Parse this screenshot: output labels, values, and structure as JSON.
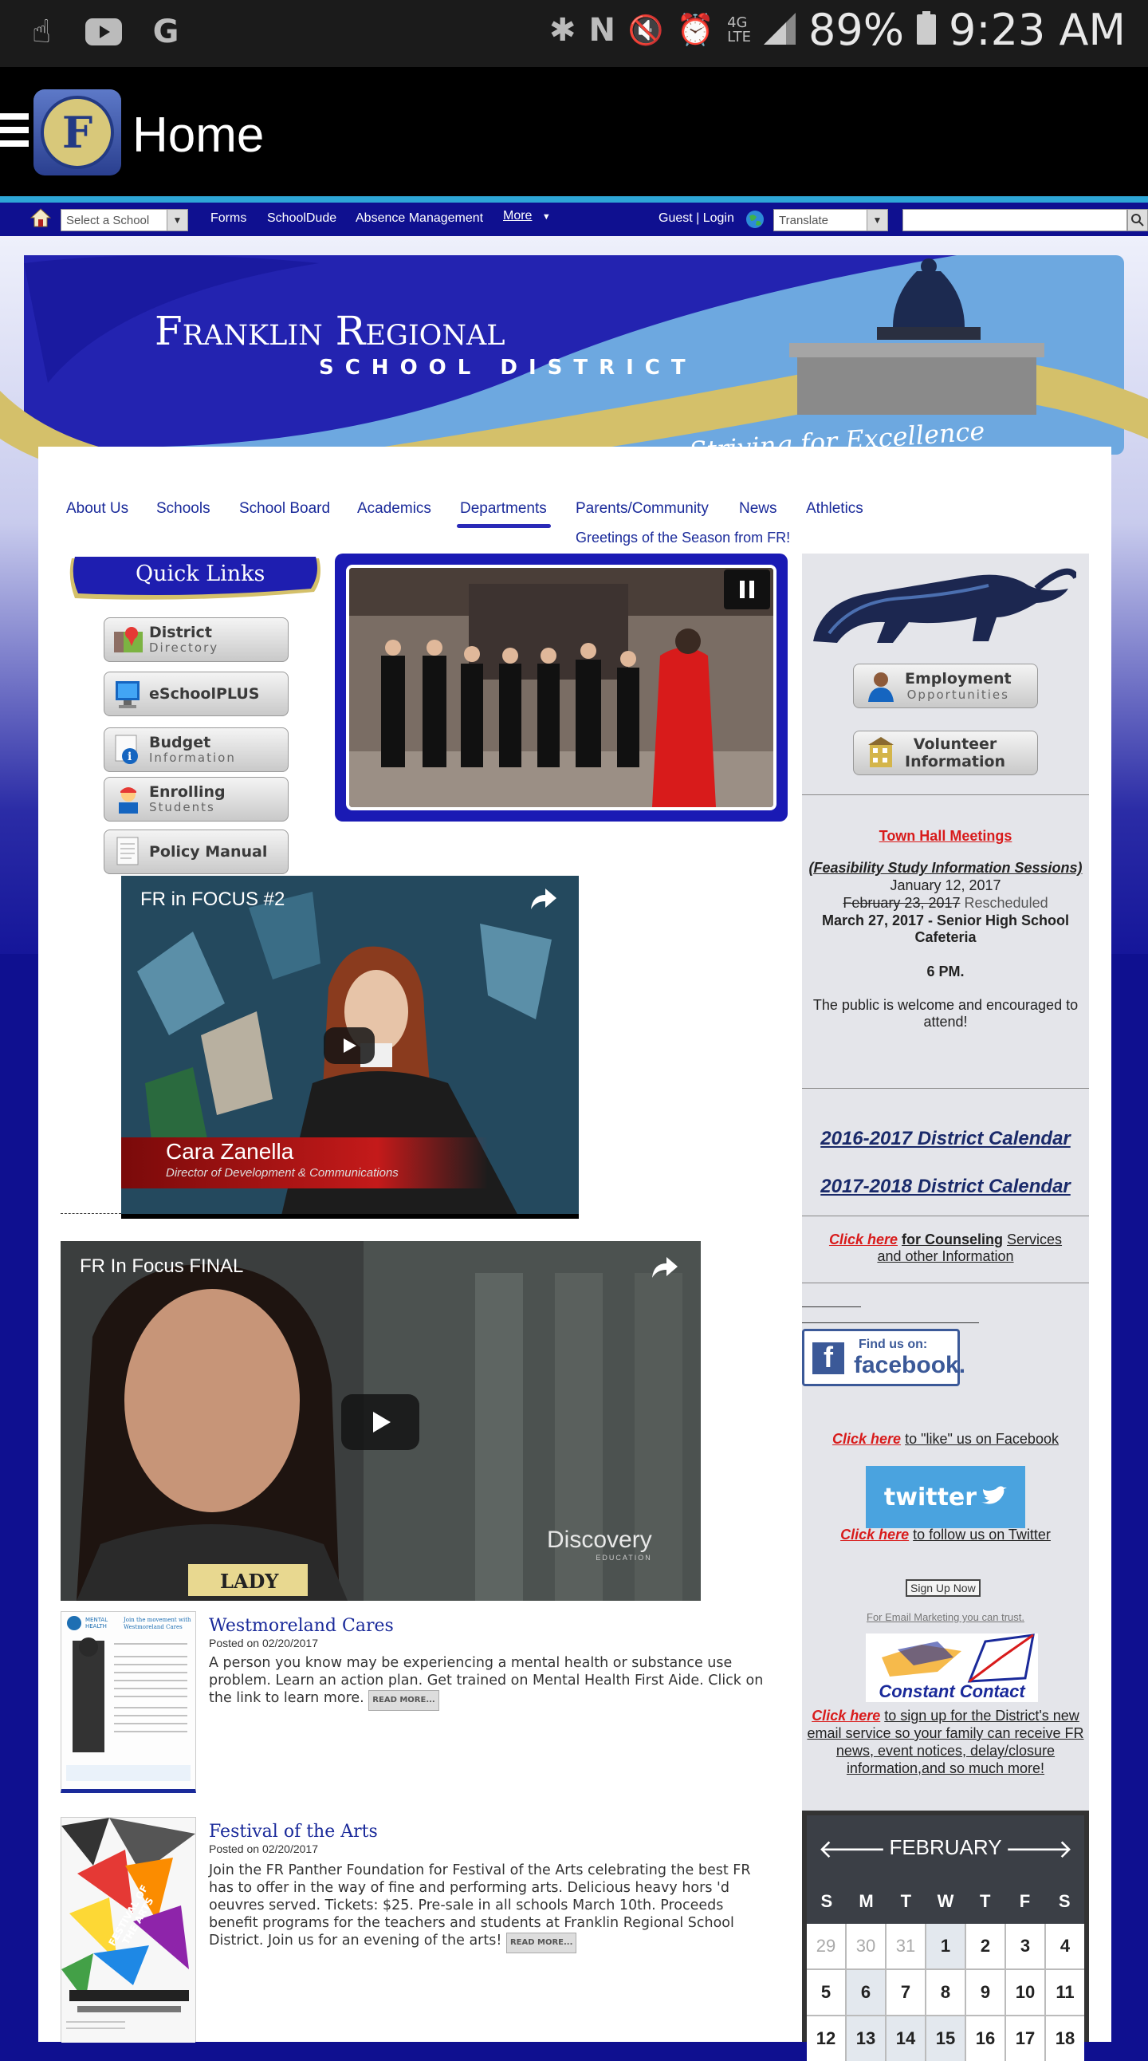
{
  "status_bar": {
    "battery": "89%",
    "time": "9:23 AM"
  },
  "app_bar": {
    "title": "Home",
    "logo_letter": "F"
  },
  "top_nav": {
    "school_select": "Select a School",
    "links": [
      "Forms",
      "SchoolDude",
      "Absence Management",
      "More"
    ],
    "login": "Guest | Login",
    "translate": "Translate"
  },
  "banner": {
    "title_line1": "Franklin Regional",
    "title_line2": "SCHOOL DISTRICT",
    "tagline": "Striving for Excellence"
  },
  "main_nav": [
    "About Us",
    "Schools",
    "School Board",
    "Academics",
    "Departments",
    "Parents/Community",
    "News",
    "Athletics"
  ],
  "greeting": "Greetings of the Season from FR!",
  "quick_links": {
    "title": "Quick Links",
    "items": [
      {
        "line1": "District",
        "line2": "Directory"
      },
      {
        "line1": "eSchoolPLUS",
        "line2": ""
      },
      {
        "line1": "Budget",
        "line2": "Information"
      },
      {
        "line1": "Enrolling",
        "line2": "Students"
      },
      {
        "line1": "Policy Manual",
        "line2": ""
      }
    ]
  },
  "videos": [
    {
      "title": "FR in FOCUS #2",
      "name": "Cara Zanella",
      "role": "Director of Development & Communications"
    },
    {
      "title": "FR In Focus FINAL",
      "brand": "Discovery",
      "brand_sub": "EDUCATION",
      "shirt": "LADY"
    }
  ],
  "right_col": {
    "buttons": [
      {
        "line1": "Employment",
        "line2": "Opportunities"
      },
      {
        "line1": "Volunteer",
        "line2": "Information"
      }
    ],
    "town_hall": {
      "heading": "Town Hall Meetings",
      "subheading": "(Feasibility Study Information Sessions)",
      "date1": "January 12, 2017",
      "date2_struck": "February 23, 2017",
      "date2_note": "Rescheduled",
      "date3": "March 27, 2017 - Senior High School Cafeteria",
      "time": "6 PM.",
      "note": "The public is welcome and encouraged to attend!"
    },
    "calendars": [
      "2016-2017 District Calendar",
      "2017-2018 District Calendar"
    ],
    "counseling": {
      "click": "Click here",
      "text1": "for Counseling",
      "text2": "Services",
      "text3": "and other Information"
    },
    "facebook": {
      "find": "Find us on:",
      "brand": "facebook.",
      "click": "Click here",
      "text": "to \"like\" us on Facebook"
    },
    "twitter": {
      "brand": "twitter",
      "click": "Click here",
      "text": "to follow us on Twitter"
    },
    "signup": "Sign Up Now",
    "email_marketing": "For Email Marketing you can trust.",
    "constant_contact": "Constant Contact",
    "cc_click": "Click here",
    "cc_text": "to sign up for the District's new email service so your family can receive FR news, event notices, delay/closure information,and so much more!"
  },
  "news": [
    {
      "title": "Westmoreland Cares",
      "date": "Posted on 02/20/2017",
      "body": "A person you know may be experiencing a mental health or substance use problem. Learn an action plan. Get trained on Mental Health First Aide. Click on the link to learn more.",
      "readmore": "READ MORE...",
      "thumb_text": "Join the movement with Westmoreland Cares"
    },
    {
      "title": "Festival of the Arts",
      "date": "Posted on 02/20/2017",
      "body": "Join the FR Panther Foundation for Festival of the Arts celebrating the best FR has to offer in the way of fine and performing arts. Delicious heavy hors 'd oeuvres served. Tickets: $25. Pre-sale in all schools March 10th. Proceeds benefit programs for the teachers and students at Franklin Regional School District. Join us for an evening of the arts!",
      "readmore": "READ MORE...",
      "thumb_text": "FESTIVAL OF THE ARTS"
    }
  ],
  "calendar": {
    "month": "FEBRUARY",
    "days_of_week": [
      "S",
      "M",
      "T",
      "W",
      "T",
      "F",
      "S"
    ],
    "days": [
      "29",
      "30",
      "31",
      "1",
      "2",
      "3",
      "4",
      "5",
      "6",
      "7",
      "8",
      "9",
      "10",
      "11",
      "12",
      "13",
      "14",
      "15",
      "16",
      "17",
      "18"
    ]
  }
}
